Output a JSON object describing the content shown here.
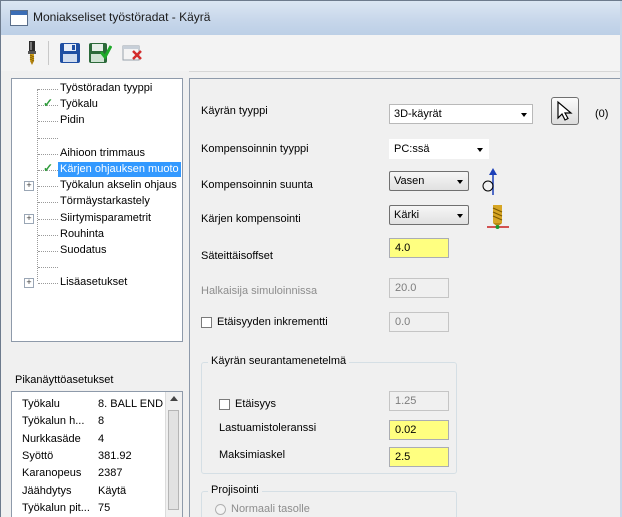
{
  "window": {
    "title": "Moniakseliset työstöradat - Käyrä"
  },
  "toolbar": {
    "buttons": [
      {
        "name": "tool-icon"
      },
      {
        "name": "save-icon"
      },
      {
        "name": "save-and-close-icon"
      },
      {
        "name": "cancel-icon"
      }
    ]
  },
  "tree": {
    "items": [
      {
        "label": "Työstöradan tyyppi",
        "checked": false,
        "expandable": false,
        "selected": false
      },
      {
        "label": "Työkalu",
        "checked": true,
        "expandable": false,
        "selected": false
      },
      {
        "label": "Pidin",
        "checked": false,
        "expandable": false,
        "selected": false
      },
      {
        "label": "",
        "checked": false,
        "expandable": false,
        "selected": false
      },
      {
        "label": "Aihioon trimmaus",
        "checked": false,
        "expandable": false,
        "selected": false
      },
      {
        "label": "Kärjen ohjauksen muoto",
        "checked": true,
        "expandable": false,
        "selected": true
      },
      {
        "label": "Työkalun akselin ohjaus",
        "checked": false,
        "expandable": true,
        "selected": false
      },
      {
        "label": "Törmäystarkastely",
        "checked": false,
        "expandable": false,
        "selected": false
      },
      {
        "label": "Siirtymisparametrit",
        "checked": false,
        "expandable": true,
        "selected": false
      },
      {
        "label": "Rouhinta",
        "checked": false,
        "expandable": false,
        "selected": false
      },
      {
        "label": "Suodatus",
        "checked": false,
        "expandable": false,
        "selected": false
      },
      {
        "label": "",
        "checked": false,
        "expandable": false,
        "selected": false
      },
      {
        "label": "Lisäasetukset",
        "checked": false,
        "expandable": true,
        "selected": false
      }
    ]
  },
  "quick_settings": {
    "title": "Pikanäyttöasetukset",
    "rows": [
      {
        "key": "Työkalu",
        "value": "8. BALL END"
      },
      {
        "key": "Työkalun h...",
        "value": "8"
      },
      {
        "key": "Nurkkasäde",
        "value": "4"
      },
      {
        "key": "Syöttö",
        "value": "381.92"
      },
      {
        "key": "Karanopeus",
        "value": "2387"
      },
      {
        "key": "Jäähdytys",
        "value": "Käytä"
      },
      {
        "key": "Työkalun pit...",
        "value": "75"
      }
    ]
  },
  "form": {
    "curve_type": {
      "label": "Käyrän tyyppi",
      "value": "3D-käyrät"
    },
    "selection_count": "(0)",
    "compensation_type": {
      "label": "Kompensoinnin tyyppi",
      "value": "PC:ssä"
    },
    "compensation_direction": {
      "label": "Kompensoinnin suunta",
      "value": "Vasen"
    },
    "tip_compensation": {
      "label": "Kärjen kompensointi",
      "value": "Kärki"
    },
    "radial_offset": {
      "label": "Säteittäisoffset",
      "value": "4.0"
    },
    "sim_diameter": {
      "label": "Halkaisija simuloinnissa",
      "value": "20.0"
    },
    "distance_increment": {
      "label": "Etäisyyden inkrementti",
      "value": "0.0"
    },
    "tracking_group": {
      "title": "Käyrän seurantamenetelmä",
      "distance": {
        "label": "Etäisyys",
        "value": "1.25"
      },
      "chord_tolerance": {
        "label": "Lastuamistoleranssi",
        "value": "0.02"
      },
      "max_step": {
        "label": "Maksimiaskel",
        "value": "2.5"
      }
    },
    "projection_group": {
      "title": "Projisointi",
      "option": "Normaali tasolle"
    }
  },
  "colors": {
    "highlight": "#3399ff",
    "yellow_field": "#ffff80",
    "check": "#2e9b3a"
  }
}
